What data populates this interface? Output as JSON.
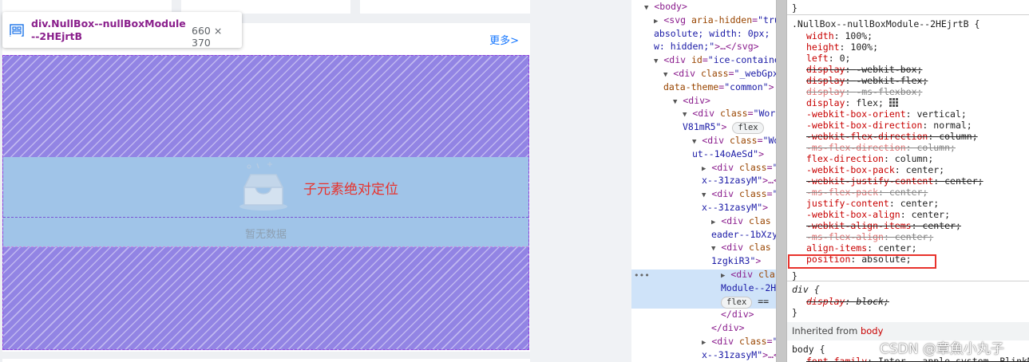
{
  "preview": {
    "more_link": "更多>",
    "empty_text": "暂无数据",
    "annotation": "子元素绝对定位",
    "tooltip": {
      "element_name": "div.NullBox--nullBoxModule--2HEjrtB",
      "element_size": "660 × 370"
    }
  },
  "elements_panel": {
    "lines": [
      {
        "indent": 0,
        "segments": [
          {
            "t": "tri",
            "v": "▼"
          },
          {
            "t": "tag",
            "v": "<body>"
          }
        ]
      },
      {
        "indent": 1,
        "segments": [
          {
            "t": "tri",
            "v": "▶"
          },
          {
            "t": "tag",
            "v": "<svg "
          },
          {
            "t": "attr",
            "v": "aria-hidden"
          },
          {
            "t": "tag",
            "v": "="
          },
          {
            "t": "val",
            "v": "\"true"
          }
        ]
      },
      {
        "indent": 1,
        "segments": [
          {
            "t": "val",
            "v": "absolute; width: 0px; h"
          }
        ]
      },
      {
        "indent": 1,
        "segments": [
          {
            "t": "val",
            "v": "w: hidden;\""
          },
          {
            "t": "tag",
            "v": ">…</svg>"
          }
        ]
      },
      {
        "indent": 1,
        "segments": [
          {
            "t": "tri",
            "v": "▼"
          },
          {
            "t": "tag",
            "v": "<div "
          },
          {
            "t": "attr",
            "v": "id"
          },
          {
            "t": "tag",
            "v": "="
          },
          {
            "t": "val",
            "v": "\"ice-container"
          }
        ]
      },
      {
        "indent": 2,
        "segments": [
          {
            "t": "tri",
            "v": "▼"
          },
          {
            "t": "tag",
            "v": "<div "
          },
          {
            "t": "attr",
            "v": "class"
          },
          {
            "t": "tag",
            "v": "="
          },
          {
            "t": "val",
            "v": "\"_webGpx5"
          }
        ]
      },
      {
        "indent": 2,
        "segments": [
          {
            "t": "attr",
            "v": "data-theme"
          },
          {
            "t": "tag",
            "v": "="
          },
          {
            "t": "val",
            "v": "\"common\""
          },
          {
            "t": "tag",
            "v": ">"
          }
        ]
      },
      {
        "indent": 3,
        "segments": [
          {
            "t": "tri",
            "v": "▼"
          },
          {
            "t": "tag",
            "v": "<div>"
          }
        ]
      },
      {
        "indent": 4,
        "segments": [
          {
            "t": "tri",
            "v": "▼"
          },
          {
            "t": "tag",
            "v": "<div "
          },
          {
            "t": "attr",
            "v": "class"
          },
          {
            "t": "tag",
            "v": "="
          },
          {
            "t": "val",
            "v": "\"Work"
          }
        ]
      },
      {
        "indent": 4,
        "segments": [
          {
            "t": "val",
            "v": "V81mR5\""
          },
          {
            "t": "tag",
            "v": "> "
          },
          {
            "t": "badge",
            "v": "flex"
          }
        ]
      },
      {
        "indent": 5,
        "segments": [
          {
            "t": "tri",
            "v": "▼"
          },
          {
            "t": "tag",
            "v": "<div "
          },
          {
            "t": "attr",
            "v": "class"
          },
          {
            "t": "tag",
            "v": "="
          },
          {
            "t": "val",
            "v": "\"Wo"
          }
        ]
      },
      {
        "indent": 5,
        "segments": [
          {
            "t": "val",
            "v": "ut--14oAeSd\""
          },
          {
            "t": "tag",
            "v": ">"
          }
        ]
      },
      {
        "indent": 6,
        "segments": [
          {
            "t": "tri",
            "v": "▶"
          },
          {
            "t": "tag",
            "v": "<div "
          },
          {
            "t": "attr",
            "v": "class"
          },
          {
            "t": "tag",
            "v": "="
          },
          {
            "t": "val",
            "v": "\"I"
          }
        ]
      },
      {
        "indent": 6,
        "segments": [
          {
            "t": "val",
            "v": "x--31zasyM\""
          },
          {
            "t": "tag",
            "v": ">…<"
          }
        ]
      },
      {
        "indent": 6,
        "segments": [
          {
            "t": "tri",
            "v": "▼"
          },
          {
            "t": "tag",
            "v": "<div "
          },
          {
            "t": "attr",
            "v": "class"
          },
          {
            "t": "tag",
            "v": "="
          },
          {
            "t": "val",
            "v": "\"I"
          }
        ]
      },
      {
        "indent": 6,
        "segments": [
          {
            "t": "val",
            "v": "x--31zasyM\""
          },
          {
            "t": "tag",
            "v": ">"
          }
        ]
      },
      {
        "indent": 7,
        "segments": [
          {
            "t": "tri",
            "v": "▶"
          },
          {
            "t": "tag",
            "v": "<div "
          },
          {
            "t": "attr",
            "v": "clas"
          }
        ]
      },
      {
        "indent": 7,
        "segments": [
          {
            "t": "val",
            "v": "eader--1bXzy"
          }
        ]
      },
      {
        "indent": 7,
        "segments": [
          {
            "t": "tri",
            "v": "▼"
          },
          {
            "t": "tag",
            "v": "<div "
          },
          {
            "t": "attr",
            "v": "clas"
          }
        ]
      },
      {
        "indent": 7,
        "segments": [
          {
            "t": "val",
            "v": "1zgkiR3\""
          },
          {
            "t": "tag",
            "v": ">"
          }
        ]
      },
      {
        "indent": 8,
        "segments": [
          {
            "t": "tri",
            "v": "▶"
          },
          {
            "t": "tag",
            "v": "<div "
          },
          {
            "t": "attr",
            "v": "clas"
          }
        ]
      },
      {
        "indent": 8,
        "segments": [
          {
            "t": "val",
            "v": "Module--2H"
          }
        ]
      },
      {
        "indent": 8,
        "segments": [
          {
            "t": "badge",
            "v": "flex"
          },
          {
            "t": "txt",
            "v": " == "
          }
        ]
      },
      {
        "indent": 8,
        "segments": [
          {
            "t": "tag",
            "v": "</div>"
          }
        ]
      },
      {
        "indent": 7,
        "segments": [
          {
            "t": "tag",
            "v": "</div>"
          }
        ]
      },
      {
        "indent": 6,
        "segments": [
          {
            "t": "tri",
            "v": "▶"
          },
          {
            "t": "tag",
            "v": "<div "
          },
          {
            "t": "attr",
            "v": "class"
          },
          {
            "t": "tag",
            "v": "="
          },
          {
            "t": "val",
            "v": "\"I"
          }
        ]
      },
      {
        "indent": 6,
        "segments": [
          {
            "t": "val",
            "v": "x--31zasyM\""
          },
          {
            "t": "tag",
            "v": ">…<"
          }
        ]
      }
    ],
    "more_dots": "•••"
  },
  "styles_panel": {
    "prev_rule_close": "}",
    "rule_selector": ".NullBox--nullBoxModule--2HEjrtB {",
    "declarations": [
      {
        "prop": "width",
        "value": "100%;",
        "struck": false
      },
      {
        "prop": "height",
        "value": "100%;",
        "struck": false
      },
      {
        "prop": "left",
        "value": "0;",
        "struck": false
      },
      {
        "prop": "display",
        "value": "-webkit-box;",
        "struck": true
      },
      {
        "prop": "display",
        "value": "-webkit-flex;",
        "struck": true
      },
      {
        "prop": "display",
        "value": "-ms-flexbox;",
        "struck": true,
        "faded": true
      },
      {
        "prop": "display",
        "value": "flex;",
        "struck": false,
        "grid_icon": true
      },
      {
        "prop": "-webkit-box-orient",
        "value": "vertical;",
        "struck": false
      },
      {
        "prop": "-webkit-box-direction",
        "value": "normal;",
        "struck": false
      },
      {
        "prop": "-webkit-flex-direction",
        "value": "column;",
        "struck": true
      },
      {
        "prop": "-ms-flex-direction",
        "value": "column;",
        "struck": true,
        "faded": true
      },
      {
        "prop": "flex-direction",
        "value": "column;",
        "struck": false
      },
      {
        "prop": "-webkit-box-pack",
        "value": "center;",
        "struck": false
      },
      {
        "prop": "-webkit-justify-content",
        "value": "center;",
        "struck": true
      },
      {
        "prop": "-ms-flex-pack",
        "value": "center;",
        "struck": true,
        "faded": true
      },
      {
        "prop": "justify-content",
        "value": "center;",
        "struck": false
      },
      {
        "prop": "-webkit-box-align",
        "value": "center;",
        "struck": false
      },
      {
        "prop": "-webkit-align-items",
        "value": "center;",
        "struck": true
      },
      {
        "prop": "-ms-flex-align",
        "value": "center;",
        "struck": true,
        "faded": true
      },
      {
        "prop": "align-items",
        "value": "center;",
        "struck": false
      },
      {
        "prop": "position",
        "value": "absolute;",
        "struck": false
      }
    ],
    "rule_close": "}",
    "div_rule": {
      "selector": "div {",
      "prop": "display",
      "value": "block;",
      "close": "}"
    },
    "inherited_label": "Inherited from",
    "inherited_tag": "body",
    "body_rule_selector": "body {",
    "body_font_line_prop": "font-family",
    "body_font_line_value": "Inter, -apple-system, BlinkMa"
  },
  "watermark": "CSDN @章魚小丸子",
  "colors": {
    "highlight_fill": "#9284e4",
    "content_band": "#a0c4e8",
    "annotation_red": "#e8322c",
    "link_blue": "#1677ff",
    "selected_row": "#cfe3f9"
  }
}
